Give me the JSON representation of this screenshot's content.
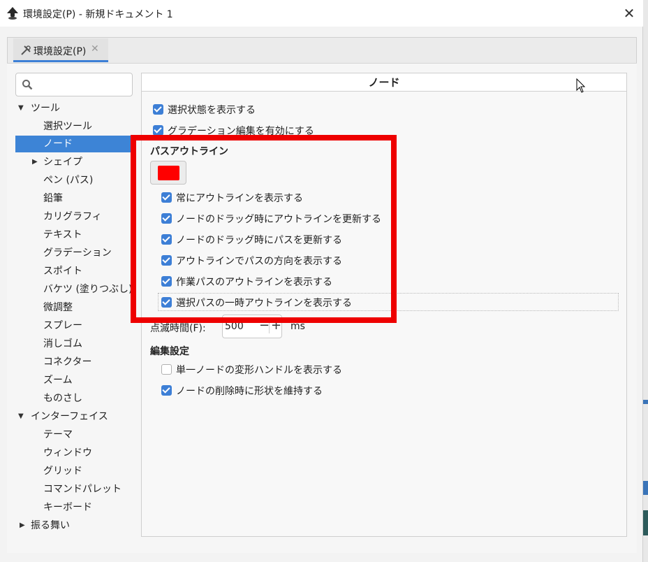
{
  "window": {
    "title": "環境設定(P) - 新規ドキュメント 1",
    "close": "✕"
  },
  "tab": {
    "label": "環境設定(P)",
    "close": "✕"
  },
  "sidebar": {
    "search_placeholder": "",
    "items": [
      {
        "label": "ツール",
        "arrow": "▼"
      },
      {
        "label": "選択ツール"
      },
      {
        "label": "ノード"
      },
      {
        "label": "シェイプ",
        "arrow": "▶"
      },
      {
        "label": "ペン (パス)"
      },
      {
        "label": "鉛筆"
      },
      {
        "label": "カリグラフィ"
      },
      {
        "label": "テキスト"
      },
      {
        "label": "グラデーション"
      },
      {
        "label": "スポイト"
      },
      {
        "label": "バケツ (塗りつぶし)"
      },
      {
        "label": "微調整"
      },
      {
        "label": "スプレー"
      },
      {
        "label": "消しゴム"
      },
      {
        "label": "コネクター"
      },
      {
        "label": "ズーム"
      },
      {
        "label": "ものさし"
      },
      {
        "label": "インターフェイス",
        "arrow": "▼"
      },
      {
        "label": "テーマ"
      },
      {
        "label": "ウィンドウ"
      },
      {
        "label": "グリッド"
      },
      {
        "label": "コマンドパレット"
      },
      {
        "label": "キーボード"
      },
      {
        "label": "振る舞い",
        "arrow": "▶"
      }
    ]
  },
  "panel": {
    "title": "ノード",
    "top_options": [
      {
        "label": "選択状態を表示する",
        "checked": true
      },
      {
        "label": "グラデーション編集を有効にする",
        "checked": true
      }
    ],
    "path_outline": {
      "title": "パスアウトライン",
      "color": "#ff0000",
      "options": [
        {
          "label": "常にアウトラインを表示する",
          "checked": true
        },
        {
          "label": "ノードのドラッグ時にアウトラインを更新する",
          "checked": true
        },
        {
          "label": "ノードのドラッグ時にパスを更新する",
          "checked": true
        },
        {
          "label": "アウトラインでパスの方向を表示する",
          "checked": true
        },
        {
          "label": "作業パスのアウトラインを表示する",
          "checked": true
        },
        {
          "label": "選択パスの一時アウトラインを表示する",
          "checked": true
        }
      ]
    },
    "blink": {
      "label": "点滅時間(F):",
      "value": "500",
      "minus": "−",
      "plus": "+",
      "unit": "ms"
    },
    "editing": {
      "title": "編集設定",
      "options": [
        {
          "label": "単一ノードの変形ハンドルを表示する",
          "checked": false
        },
        {
          "label": "ノードの削除時に形状を維持する",
          "checked": true
        }
      ]
    }
  },
  "colors": {
    "accent": "#3d7fd6",
    "highlight": "#ee0000"
  }
}
